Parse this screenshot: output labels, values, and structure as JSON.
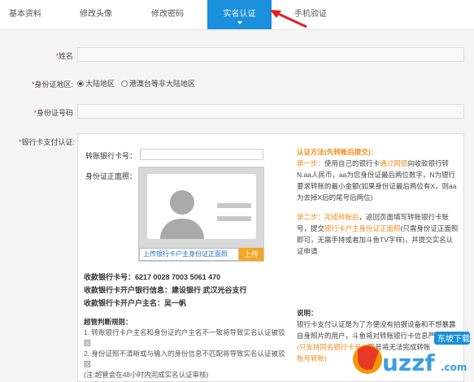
{
  "tabs": [
    {
      "label": "基本资料"
    },
    {
      "label": "修改头像"
    },
    {
      "label": "修改密码"
    },
    {
      "label": "实名认证"
    },
    {
      "label": "手机验证"
    }
  ],
  "form": {
    "name_label": "姓名",
    "region_label": "身份证地区",
    "region_options": [
      "大陆地区",
      "港澳台等非大陆地区"
    ],
    "region_selected": "大陆地区",
    "id_label": "身份证号码",
    "bank_label": "银行卡支付认证"
  },
  "bank": {
    "transfer_card_label": "转账银行卡号",
    "id_photo_label": "身份证正面照",
    "upload_link": "上传银行卡户主身份证正面照",
    "upload_button": "上传",
    "receive_card": "收款银行卡号：6217 0028 7003 5061 470",
    "receive_bank": "收款银行卡开户银行信息：建设银行 武汉光谷支行",
    "receive_owner": "收款银行卡开户户主名：吴一帆",
    "rules_title": "超管判断规则：",
    "rule1": "1. 转账银行卡户主名和身份证的户主名不一致将导致实名认证被驳回",
    "rule2": "2. 身份证照不清晰或与输入的身份信息不匹配将导致实名认证被驳回",
    "rule3": "(注:超管会在48小时内完成实名认证审核)"
  },
  "right_panel": {
    "method_title": "认证方法(先转账后提交)：",
    "step1_label": "第一步：",
    "step1_a": "使用自己的银行卡",
    "step1_link": "通过网银",
    "step1_b": "向收款银行转N.aa人民币，aa为您身份证最后两位数字，N为银行要求转账的最小金额(如果身份证最后两位有X，则aa为去掉X后的尾号后两位)",
    "step2_label": "第二步：",
    "step2_a": "完成转账后",
    "step2_b": "，返回页面填写转账银行卡账号，提交",
    "step2_link": "银行卡户主身份证正面照",
    "step2_c": "(只需身份证正面照即可，无需手持或者加斗鱼TV字样)，并提交实名认证申请",
    "note_title": "说明：",
    "note_a": "银行卡支付认证是为了方便没有拍摄设备和不想暴露自身照片的用户，斗鱼将对转账银行卡信息严格保密",
    "note_b": "(只支持同名银行卡号",
    "note_c": "账号转账)",
    "note_d": "，账号将无法完成转账"
  },
  "watermark": {
    "text": "uzzf.com",
    "sub": "东坡下载"
  }
}
